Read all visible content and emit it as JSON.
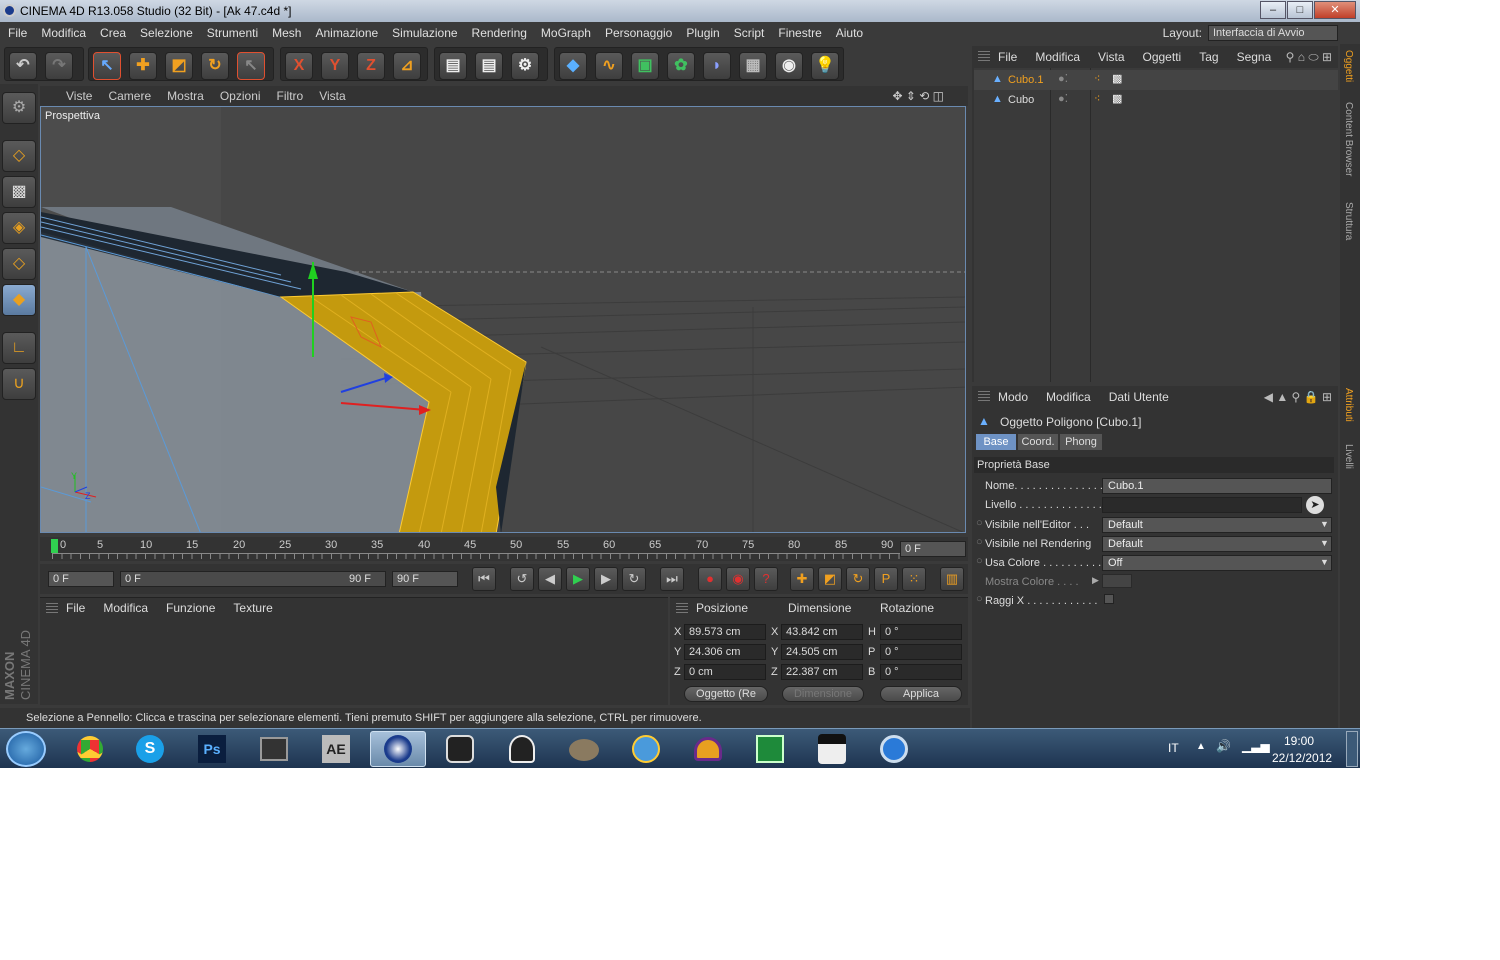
{
  "window": {
    "title": "CINEMA 4D R13.058 Studio (32 Bit) - [Ak 47.c4d *]"
  },
  "menu": [
    "File",
    "Modifica",
    "Crea",
    "Selezione",
    "Strumenti",
    "Mesh",
    "Animazione",
    "Simulazione",
    "Rendering",
    "MoGraph",
    "Personaggio",
    "Plugin",
    "Script",
    "Finestre",
    "Aiuto"
  ],
  "layout": {
    "label": "Layout:",
    "value": "Interfaccia di Avvio"
  },
  "toolbar": {
    "undo_icon": "undo-icon",
    "x": "X",
    "y": "Y",
    "z": "Z"
  },
  "viewport": {
    "menu": [
      "Viste",
      "Camere",
      "Mostra",
      "Opzioni",
      "Filtro",
      "Vista"
    ],
    "label": "Prospettiva",
    "axis_y": "Y",
    "axis_z": "Z"
  },
  "timeline": {
    "ticks": [
      "0",
      "5",
      "10",
      "15",
      "20",
      "25",
      "30",
      "35",
      "40",
      "45",
      "50",
      "55",
      "60",
      "65",
      "70",
      "75",
      "80",
      "85",
      "90"
    ],
    "current_frame": "0 F",
    "start": "0 F",
    "range_start": "0 F",
    "range_end": "90 F",
    "end": "90 F"
  },
  "material_panel": {
    "menu": [
      "File",
      "Modifica",
      "Funzione",
      "Texture"
    ]
  },
  "coords": {
    "headers": [
      "Posizione",
      "Dimensione",
      "Rotazione"
    ],
    "rows": [
      {
        "a": "X",
        "pos": "89.573 cm",
        "b": "X",
        "dim": "43.842 cm",
        "c": "H",
        "rot": "0 °"
      },
      {
        "a": "Y",
        "pos": "24.306 cm",
        "b": "Y",
        "dim": "24.505 cm",
        "c": "P",
        "rot": "0 °"
      },
      {
        "a": "Z",
        "pos": "0 cm",
        "b": "Z",
        "dim": "22.387 cm",
        "c": "B",
        "rot": "0 °"
      }
    ],
    "mode": "Oggetto (Re",
    "dim_mode": "Dimensione",
    "apply": "Applica"
  },
  "status": "Selezione a Pennello: Clicca e trascina per selezionare elementi. Tieni premuto SHIFT per aggiungere alla selezione, CTRL per rimuovere.",
  "brand": {
    "maxon": "MAXON",
    "cinema": "CINEMA 4D"
  },
  "object_manager": {
    "menu": [
      "File",
      "Modifica",
      "Vista",
      "Oggetti",
      "Tag",
      "Segna"
    ],
    "objects": [
      {
        "name": "Cubo.1",
        "selected": true
      },
      {
        "name": "Cubo",
        "selected": false
      }
    ]
  },
  "attributes": {
    "menu": [
      "Modo",
      "Modifica",
      "Dati Utente"
    ],
    "title": "Oggetto Poligono [Cubo.1]",
    "tabs": [
      "Base",
      "Coord.",
      "Phong"
    ],
    "section": "Proprietà Base",
    "props": [
      {
        "label": "Nome. . . . . . . . . . . . . . .",
        "value": "Cubo.1"
      },
      {
        "label": "Livello . . . . . . . . . . . . . .",
        "value": ""
      },
      {
        "label": "Visibile nell'Editor . . .",
        "value": "Default"
      },
      {
        "label": "Visibile nel Rendering",
        "value": "Default"
      },
      {
        "label": "Usa Colore . . . . . . . . . .",
        "value": "Off"
      },
      {
        "label": "Mostra Colore . . . .",
        "value": ""
      },
      {
        "label": "Raggi X . . . . . . . . . . . .",
        "value": ""
      }
    ]
  },
  "side_tabs": [
    "Oggetti",
    "Content Browser",
    "Struttura",
    "Attributi",
    "Livelli"
  ],
  "taskbar": {
    "apps": [
      "Chrome",
      "Skype",
      "Ps",
      "Media",
      "AE",
      "Cinema 4D",
      "Gecko",
      "Inkscape",
      "GIMP",
      "Map",
      "Audio",
      "Excel",
      "Face",
      "Circle"
    ],
    "app_labels": {
      "ps": "Ps",
      "ae": "AE"
    },
    "lang": "IT",
    "time": "19:00",
    "date": "22/12/2012"
  }
}
